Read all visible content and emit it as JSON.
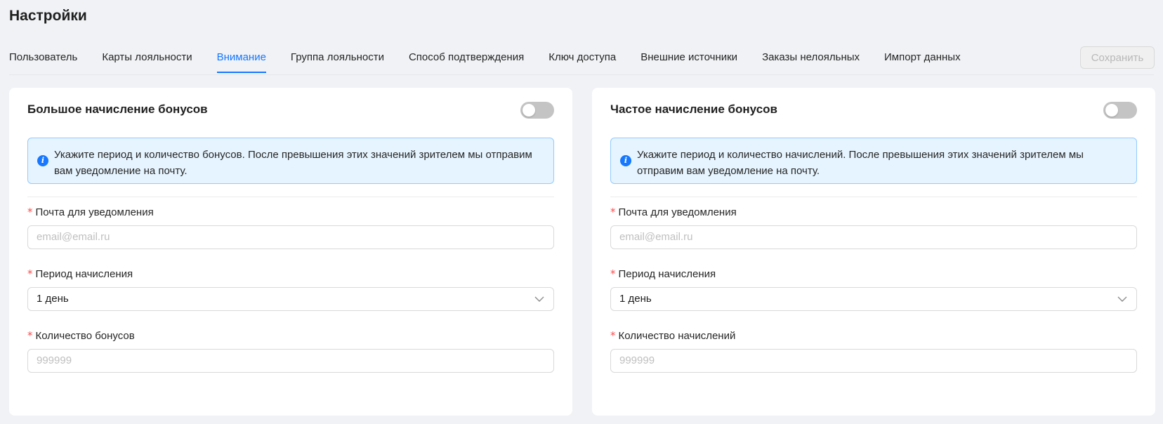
{
  "page": {
    "title": "Настройки"
  },
  "tabs": [
    {
      "label": "Пользователь",
      "active": false
    },
    {
      "label": "Карты лояльности",
      "active": false
    },
    {
      "label": "Внимание",
      "active": true
    },
    {
      "label": "Группа лояльности",
      "active": false
    },
    {
      "label": "Способ подтверждения",
      "active": false
    },
    {
      "label": "Ключ доступа",
      "active": false
    },
    {
      "label": "Внешние источники",
      "active": false
    },
    {
      "label": "Заказы нелояльных",
      "active": false
    },
    {
      "label": "Импорт данных",
      "active": false
    }
  ],
  "toolbar": {
    "save_label": "Сохранить",
    "save_disabled": true
  },
  "cards": [
    {
      "title": "Большое начисление бонусов",
      "enabled": false,
      "info_text": "Укажите период и количество бонусов. После превышения этих значений зрителем мы отправим вам уведомление на почту.",
      "email_label": "Почта для уведомления",
      "email_placeholder": "email@email.ru",
      "email_value": "",
      "period_label": "Период начисления",
      "period_value": "1 день",
      "count_label": "Количество бонусов",
      "count_placeholder": "999999",
      "count_value": ""
    },
    {
      "title": "Частое начисление бонусов",
      "enabled": false,
      "info_text": "Укажите период и количество начислений. После превышения этих значений зрителем мы отправим вам уведомление на почту.",
      "email_label": "Почта для уведомления",
      "email_placeholder": "email@email.ru",
      "email_value": "",
      "period_label": "Период начисления",
      "period_value": "1 день",
      "count_label": "Количество начислений",
      "count_placeholder": "999999",
      "count_value": ""
    }
  ],
  "colors": {
    "accent": "#1677ff",
    "required": "#ff4d4f",
    "info_bg": "#e6f4ff",
    "info_border": "#91caff"
  },
  "icons": {
    "info": "info-icon",
    "select_arrow": "chevron-down-icon"
  }
}
